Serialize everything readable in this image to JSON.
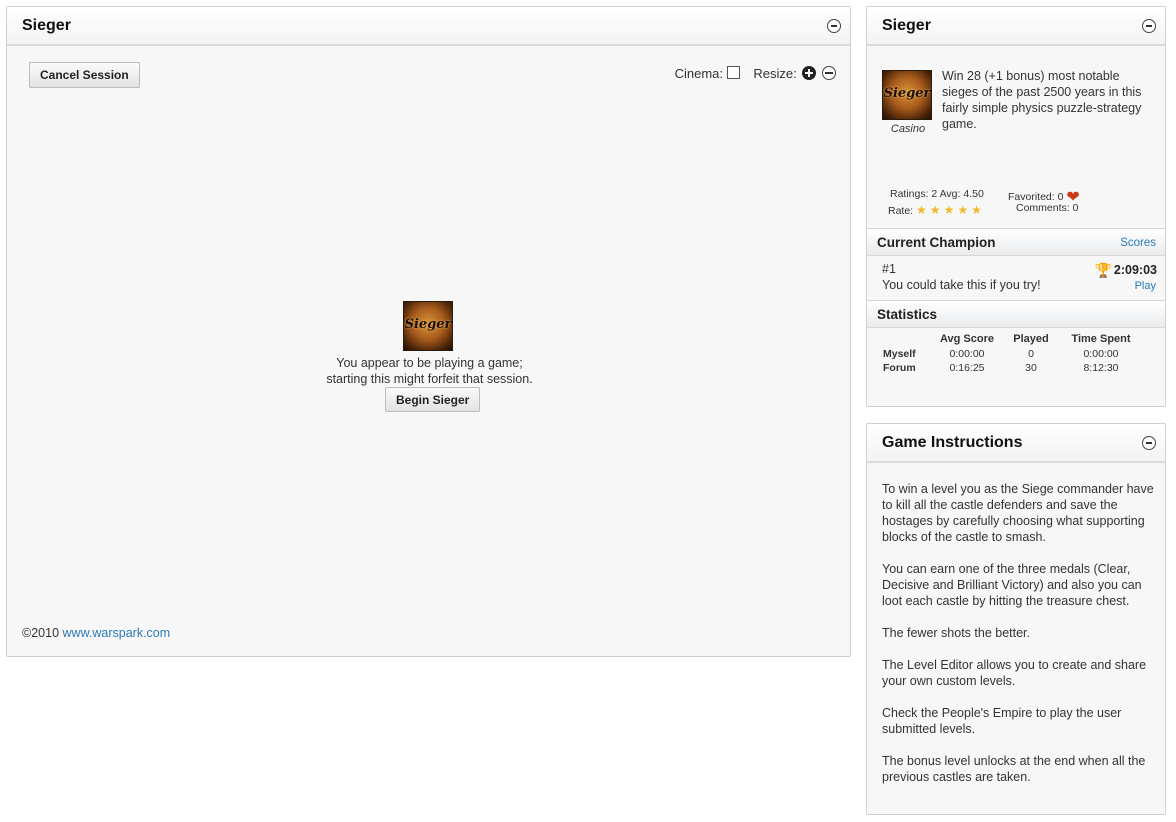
{
  "main": {
    "title": "Sieger",
    "cancel_label": "Cancel Session",
    "cinema_label": "Cinema:",
    "resize_label": "Resize:",
    "logo_text": "Sieger",
    "msg_line1": "You appear to be playing a game;",
    "msg_line2": "starting this might forfeit that session.",
    "begin_label": "Begin Sieger",
    "copyright": "©2010",
    "site_link": "www.warspark.com"
  },
  "info": {
    "title": "Sieger",
    "logo_text": "Sieger",
    "genre": "Casino",
    "description": "Win 28 (+1 bonus) most notable sieges of the past 2500 years in this fairly simple physics puzzle-strategy game.",
    "ratings": "Ratings: 2 Avg: 4.50",
    "rate_label": "Rate:",
    "favorited": "Favorited: 0",
    "comments": "Comments: 0",
    "stars": [
      "★",
      "★",
      "★",
      "★",
      "★"
    ]
  },
  "champion": {
    "title": "Current Champion",
    "scores_link": "Scores",
    "rank": "#1",
    "message": "You could take this if you try!",
    "time": "2:09:03",
    "play_link": "Play"
  },
  "statistics": {
    "title": "Statistics",
    "headers": [
      "Avg Score",
      "Played",
      "Time Spent"
    ],
    "rows": [
      {
        "label": "Myself",
        "avg": "0:00:00",
        "played": "0",
        "time": "0:00:00"
      },
      {
        "label": "Forum",
        "avg": "0:16:25",
        "played": "30",
        "time": "8:12:30"
      }
    ]
  },
  "instructions": {
    "title": "Game Instructions",
    "paragraphs": [
      "To win a level you as the Siege commander have to kill all the castle defenders and save the hostages by carefully choosing what supporting blocks of the castle to smash.",
      "You can earn one of the three medals (Clear, Decisive and Brilliant Victory) and also you can loot each castle by hitting the treasure chest.",
      "The fewer shots the better.",
      "The Level Editor allows you to create and share your own custom levels.",
      "Check the People's Empire to play the user submitted levels.",
      "The bonus level unlocks at the end when all the previous castles are taken."
    ]
  }
}
